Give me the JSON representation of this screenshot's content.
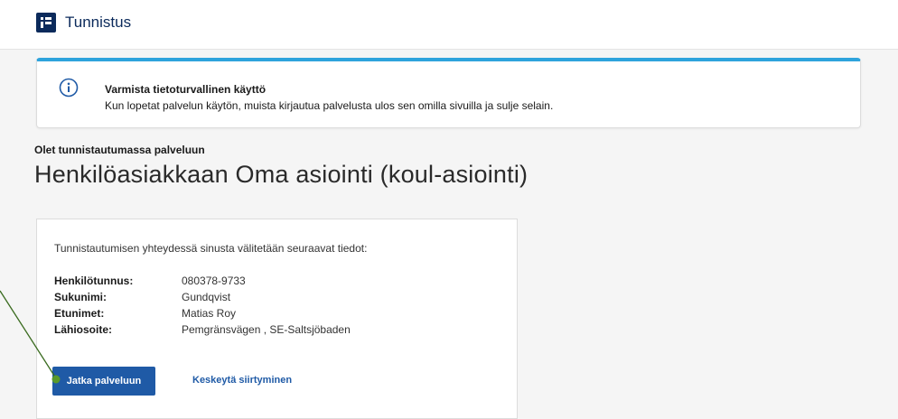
{
  "header": {
    "app_name": "Tunnistus",
    "logo_icon": "tunnistus-logo-icon"
  },
  "notice": {
    "icon": "info-icon",
    "title": "Varmista tietoturvallinen käyttö",
    "text": "Kun lopetat palvelun käytön, muista kirjautua palvelusta ulos sen omilla sivuilla ja sulje selain.",
    "accent_color": "#2ea3dc"
  },
  "main": {
    "subtitle": "Olet tunnistautumassa palveluun",
    "service_name": "Henkilöasiakkaan Oma asiointi (koul-asiointi)"
  },
  "card": {
    "intro": "Tunnistautumisen yhteydessä sinusta välitetään seuraavat tiedot:",
    "fields": [
      {
        "label": "Henkilötunnus:",
        "value": "080378-9733"
      },
      {
        "label": "Sukunimi:",
        "value": "Gundqvist"
      },
      {
        "label": "Etunimet:",
        "value": "Matias Roy"
      },
      {
        "label": "Lähiosoite:",
        "value": "Pemgränsvägen , SE-Saltsjöbaden"
      }
    ],
    "continue_label": "Jatka palveluun",
    "cancel_label": "Keskeytä siirtyminen",
    "primary_color": "#1f5aa6"
  },
  "annotation": {
    "color": "#3a6b1f"
  }
}
